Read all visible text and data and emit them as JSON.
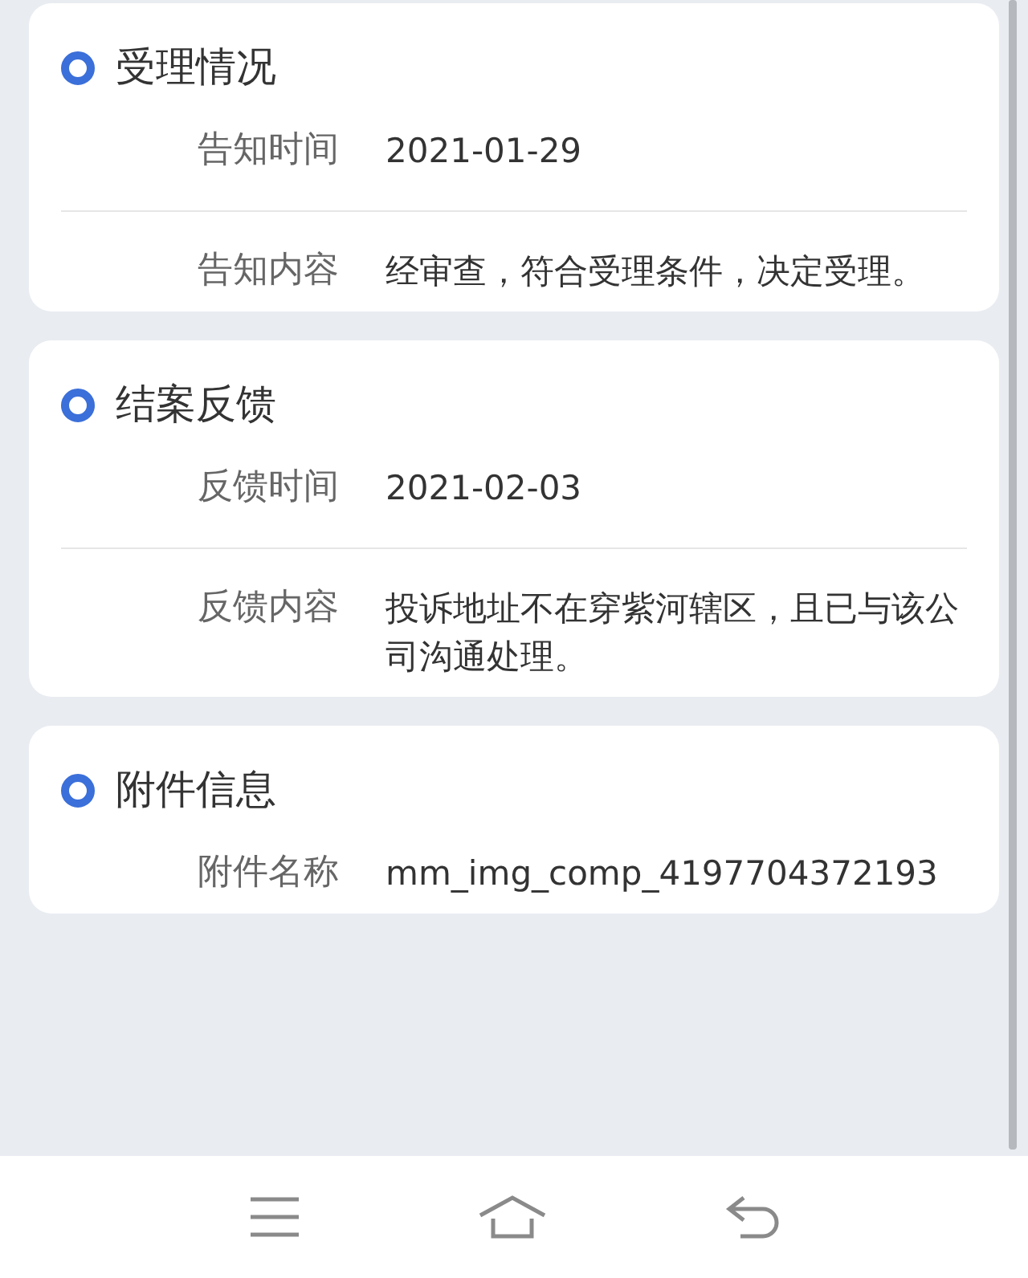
{
  "sections": [
    {
      "title": "受理情况",
      "rows": [
        {
          "label": "告知时间",
          "value": "2021-01-29"
        },
        {
          "label": "告知内容",
          "value": "经审查，符合受理条件，决定受理。"
        }
      ]
    },
    {
      "title": "结案反馈",
      "rows": [
        {
          "label": "反馈时间",
          "value": "2021-02-03"
        },
        {
          "label": "反馈内容",
          "value": "投诉地址不在穿紫河辖区，且已与该公司沟通处理。"
        }
      ]
    },
    {
      "title": "附件信息",
      "rows": [
        {
          "label": "附件名称",
          "value": "mm_img_comp_4197704372193"
        }
      ]
    }
  ]
}
